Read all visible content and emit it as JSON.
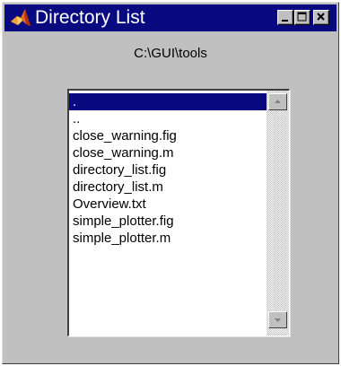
{
  "window": {
    "title": "Directory List",
    "icon": "matlab-logo-icon",
    "buttons": [
      "minimize-icon",
      "maximize-icon",
      "close-icon"
    ]
  },
  "path_label": "C:\\GUI\\tools",
  "listbox": {
    "selected_index": 0,
    "items": [
      ".",
      "..",
      "close_warning.fig",
      "close_warning.m",
      "directory_list.fig",
      "directory_list.m",
      "Overview.txt",
      "simple_plotter.fig",
      "simple_plotter.m"
    ]
  },
  "colors": {
    "titlebar": "#0a0a80",
    "selection": "#0a0a80",
    "window_bg": "#c0c0c0"
  }
}
